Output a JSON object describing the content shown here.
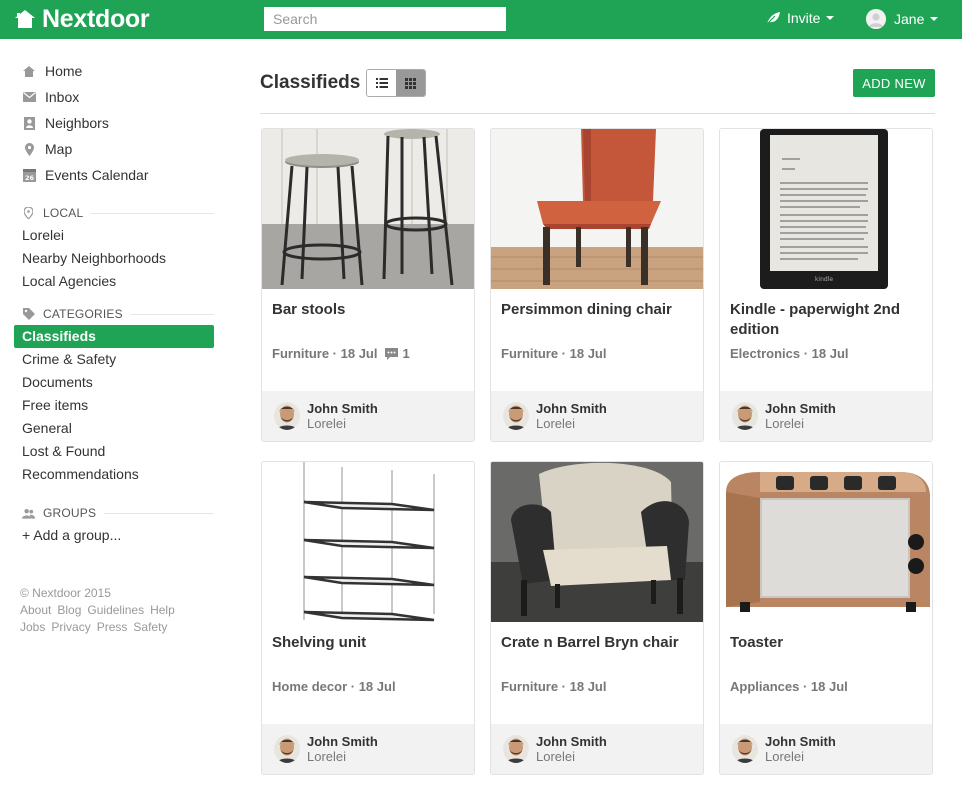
{
  "app": {
    "brand": "Nextdoor",
    "brand_color": "#1fa456"
  },
  "search": {
    "placeholder": "Search",
    "value": ""
  },
  "header": {
    "invite_label": "Invite",
    "user_name": "Jane"
  },
  "sidebar": {
    "nav": [
      {
        "label": "Home",
        "icon": "home-icon"
      },
      {
        "label": "Inbox",
        "icon": "inbox-icon"
      },
      {
        "label": "Neighbors",
        "icon": "neighbors-icon"
      },
      {
        "label": "Map",
        "icon": "map-pin-icon"
      },
      {
        "label": "Events Calendar",
        "icon": "calendar-icon"
      }
    ],
    "local": {
      "heading": "LOCAL",
      "items": [
        "Lorelei",
        "Nearby Neighborhoods",
        "Local Agencies"
      ]
    },
    "categories": {
      "heading": "CATEGORIES",
      "items": [
        "Classifieds",
        "Crime & Safety",
        "Documents",
        "Free items",
        "General",
        "Lost & Found",
        "Recommendations"
      ],
      "active": "Classifieds"
    },
    "groups": {
      "heading": "GROUPS",
      "add_label": "+ Add a group..."
    },
    "footer": {
      "copyright": "© Nextdoor 2015",
      "links_row1": [
        "About",
        "Blog",
        "Guidelines",
        "Help"
      ],
      "links_row2": [
        "Jobs",
        "Privacy",
        "Press",
        "Safety"
      ]
    }
  },
  "main": {
    "title": "Classifieds",
    "add_new_label": "ADD NEW",
    "view_mode": "grid",
    "listings": [
      {
        "title": "Bar stools",
        "category": "Furniture",
        "date": "18 Jul",
        "comments": "1",
        "author": "John Smith",
        "place": "Lorelei",
        "image": "bar-stools"
      },
      {
        "title": "Persimmon dining chair",
        "category": "Furniture",
        "date": "18 Jul",
        "comments": "",
        "author": "John Smith",
        "place": "Lorelei",
        "image": "dining-chair"
      },
      {
        "title": "Kindle - paperwight 2nd edition",
        "category": "Electronics",
        "date": "18 Jul",
        "comments": "",
        "author": "John Smith",
        "place": "Lorelei",
        "image": "kindle"
      },
      {
        "title": "Shelving unit",
        "category": "Home decor",
        "date": "18 Jul",
        "comments": "",
        "author": "John Smith",
        "place": "Lorelei",
        "image": "shelving"
      },
      {
        "title": "Crate n Barrel Bryn chair",
        "category": "Furniture",
        "date": "18 Jul",
        "comments": "",
        "author": "John Smith",
        "place": "Lorelei",
        "image": "armchair"
      },
      {
        "title": "Toaster",
        "category": "Appliances",
        "date": "18 Jul",
        "comments": "",
        "author": "John Smith",
        "place": "Lorelei",
        "image": "toaster"
      }
    ]
  }
}
